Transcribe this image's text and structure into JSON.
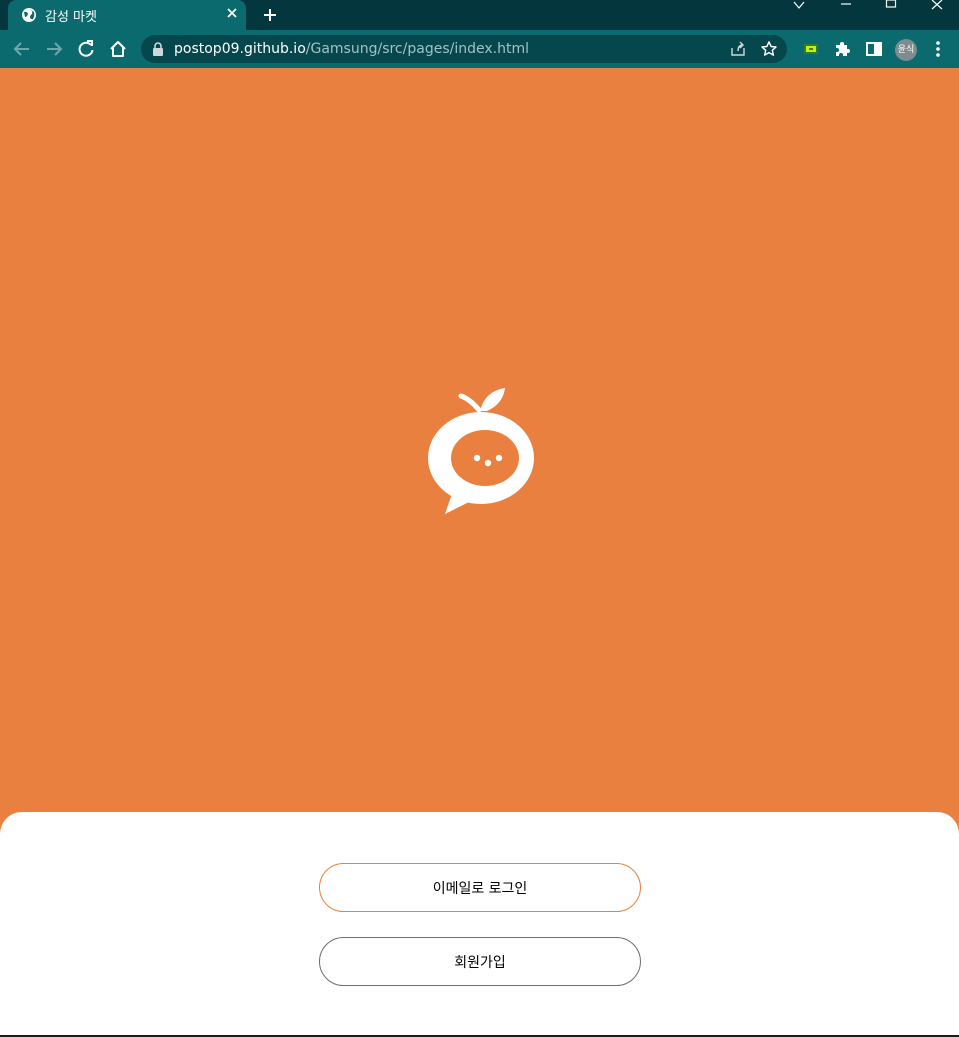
{
  "browser": {
    "tab_title": "감성 마켓",
    "url_host": "postop09.github.io",
    "url_path": "/Gamsung/src/pages/index.html",
    "profile_label": "윤식",
    "theme_color": "#0B6A6E"
  },
  "page": {
    "background_color": "#E9803F",
    "login_button_label": "이메일로 로그인",
    "signup_button_label": "회원가입"
  }
}
